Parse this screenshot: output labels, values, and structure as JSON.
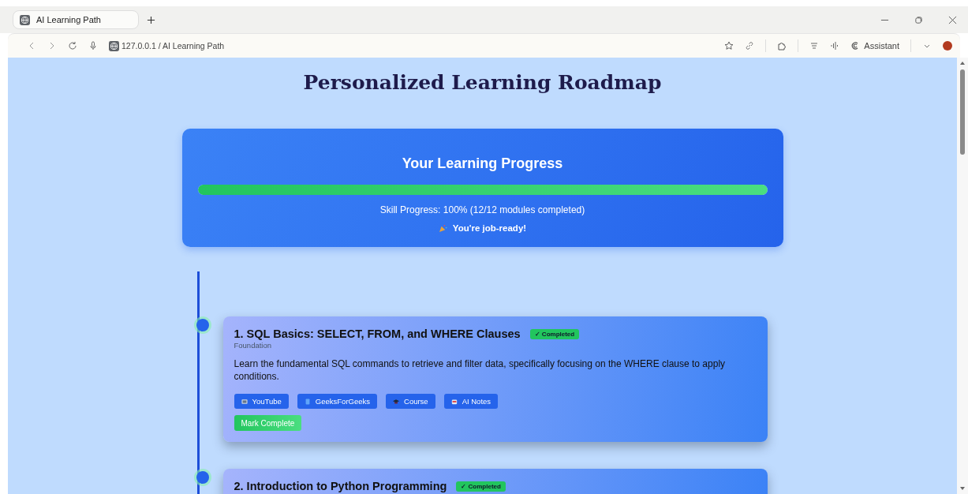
{
  "browser": {
    "tab_title": "AI Learning Path",
    "address": "127.0.0.1 / AI Learning Path",
    "assistant_label": "Assistant"
  },
  "page_title": "Personalized Learning Roadmap",
  "progress": {
    "heading": "Your Learning Progress",
    "level": 1,
    "summary": "Skill Progress: 100% (12/12 modules completed)",
    "message": "You're job-ready!"
  },
  "modules": [
    {
      "title": "1. SQL Basics: SELECT, FROM, and WHERE Clauses",
      "completed": true,
      "badge": "✓ Completed",
      "category": "Foundation",
      "description": "Learn the fundamental SQL commands to retrieve and filter data, specifically focusing on the WHERE clause to apply conditions.",
      "resources": [
        {
          "kind": "video",
          "label": "YouTube"
        },
        {
          "kind": "book",
          "label": "GeeksForGeeks"
        },
        {
          "kind": "course",
          "label": "Course"
        },
        {
          "kind": "notes",
          "label": "AI Notes"
        }
      ],
      "action": "Mark Complete"
    },
    {
      "title": "2. Introduction to Python Programming",
      "completed": true,
      "badge": "✓ Completed"
    }
  ]
}
